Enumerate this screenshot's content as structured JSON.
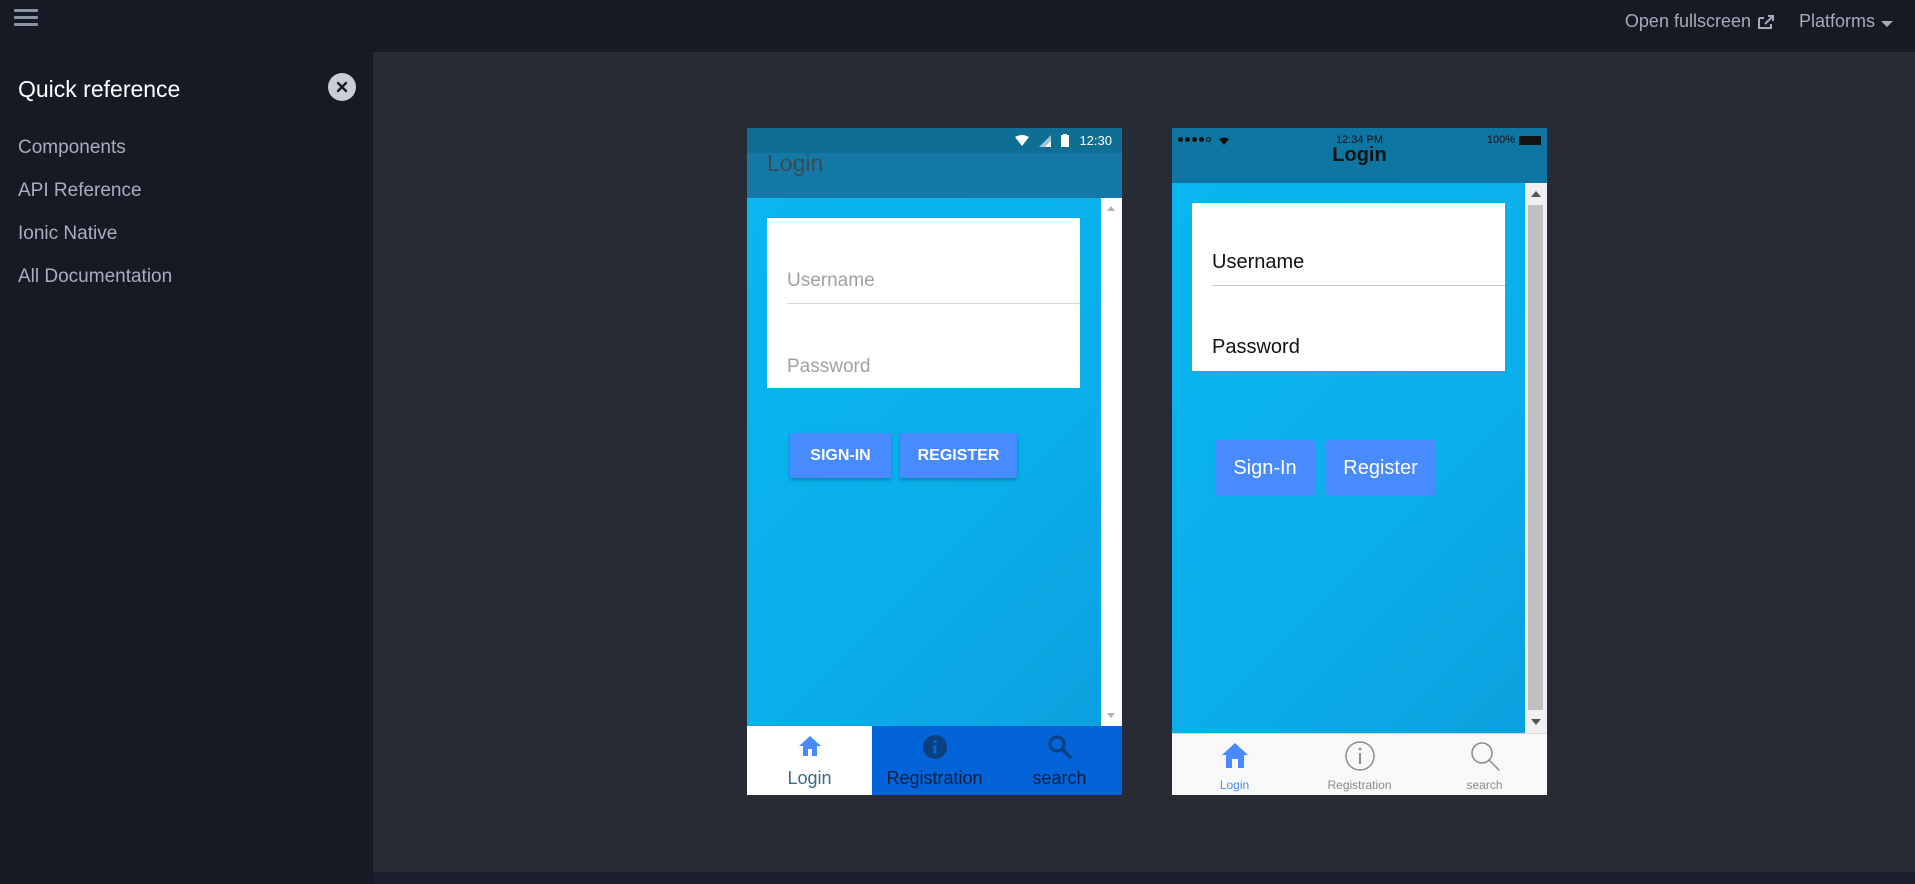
{
  "topbar": {
    "fullscreen_label": "Open fullscreen",
    "platforms_label": "Platforms"
  },
  "sidebar": {
    "title": "Quick reference",
    "items": [
      {
        "label": "Components"
      },
      {
        "label": "API Reference"
      },
      {
        "label": "Ionic Native"
      },
      {
        "label": "All Documentation"
      }
    ]
  },
  "android": {
    "status_time": "12:30",
    "title": "Login",
    "username_placeholder": "Username",
    "password_placeholder": "Password",
    "signin_label": "SIGN-IN",
    "register_label": "REGISTER",
    "tabs": [
      {
        "label": "Login",
        "icon": "home-icon"
      },
      {
        "label": "Registration",
        "icon": "info-icon"
      },
      {
        "label": "search",
        "icon": "search-icon"
      }
    ]
  },
  "ios": {
    "status_time": "12:34 PM",
    "battery": "100%",
    "title": "Login",
    "username_label": "Username",
    "password_label": "Password",
    "signin_label": "Sign-In",
    "register_label": "Register",
    "tabs": [
      {
        "label": "Login",
        "icon": "home-icon"
      },
      {
        "label": "Registration",
        "icon": "info-icon"
      },
      {
        "label": "search",
        "icon": "search-icon"
      }
    ]
  },
  "colors": {
    "accent": "#488aff",
    "content_gradient": "#09b6ef",
    "android_tabbar": "#0264d8"
  }
}
